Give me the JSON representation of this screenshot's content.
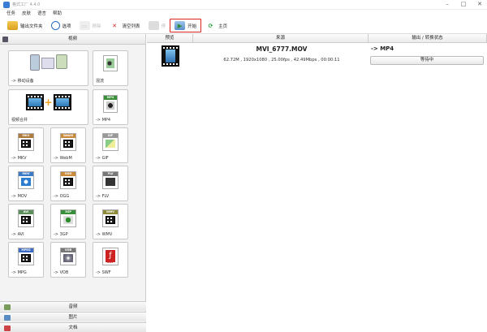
{
  "window": {
    "title": "格式工厂 4.4.0"
  },
  "menu": [
    "任务",
    "皮肤",
    "语言",
    "帮助"
  ],
  "toolbar": {
    "output_folder": "输出文件夹",
    "options": "选项",
    "remove": "移除",
    "clear_list": "清空列表",
    "stop": "停",
    "start": "开始",
    "home": "主页"
  },
  "sidebar": {
    "header": "视频",
    "tiles": {
      "mobile": "-> 移动设备",
      "watermark": "混流",
      "join": "视频合并",
      "mp4": "-> MP4",
      "mkv": "-> MKV",
      "webm": "-> WebM",
      "gif": "-> GIF",
      "mov": "-> MOV",
      "ogg": "-> OGG",
      "flv": "-> FLV",
      "avi": "-> AVI",
      "3gp": "-> 3GP",
      "wmv": "-> WMV",
      "mpg": "-> MPG",
      "vob": "-> VOB",
      "swf": "-> SWF"
    },
    "badges": {
      "mp4": "MP4",
      "mkv": "MKV",
      "webm": "WebM",
      "gif": "GIF",
      "mov": "MOV",
      "ogg": "OGG",
      "flv": "FLV",
      "avi": "AVI",
      "3gp": "3GP",
      "wmv": "WMV",
      "mpg": "MPEG",
      "vob": "VOB",
      "swf": "SWF"
    },
    "footer": {
      "audio": "音频",
      "picture": "图片",
      "document": "文档"
    }
  },
  "list": {
    "columns": {
      "preview": "预览",
      "source": "来源",
      "output": "输出 / 转换状态"
    },
    "rows": [
      {
        "filename": "MVI_6777.MOV",
        "meta": "62.72M , 1920x1080 , 25.00fps , 42.49Mbps , 00:00:11",
        "target": "-> MP4",
        "status": "等待中"
      }
    ]
  },
  "colors": {
    "highlight": "#dd2222",
    "accent": "#2a6cc4"
  }
}
